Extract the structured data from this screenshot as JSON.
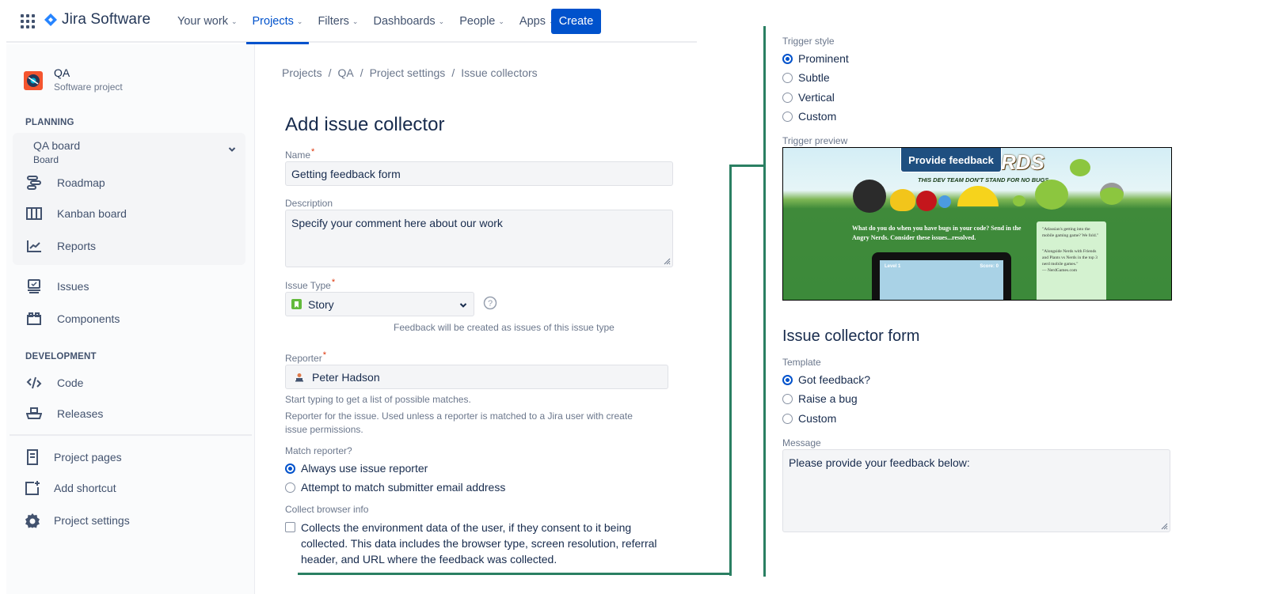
{
  "app": {
    "brand": "Jira Software",
    "nav": [
      {
        "label": "Your work",
        "active": false
      },
      {
        "label": "Projects",
        "active": true
      },
      {
        "label": "Filters",
        "active": false
      },
      {
        "label": "Dashboards",
        "active": false
      },
      {
        "label": "People",
        "active": false
      },
      {
        "label": "Apps",
        "active": false
      }
    ],
    "create_label": "Create",
    "accent": "#0052cc"
  },
  "sidebar": {
    "project_name": "QA",
    "project_type": "Software project",
    "planning_title": "PLANNING",
    "board": {
      "name": "QA board",
      "sub": "Board"
    },
    "planning_items": [
      {
        "label": "Roadmap",
        "icon": "roadmap-icon"
      },
      {
        "label": "Kanban board",
        "icon": "kanban-board-icon"
      },
      {
        "label": "Reports",
        "icon": "reports-icon"
      }
    ],
    "items": [
      {
        "label": "Issues",
        "icon": "issues-icon"
      },
      {
        "label": "Components",
        "icon": "components-icon"
      }
    ],
    "development_title": "DEVELOPMENT",
    "development_items": [
      {
        "label": "Code",
        "icon": "code-icon"
      },
      {
        "label": "Releases",
        "icon": "releases-icon"
      }
    ],
    "footer_items": [
      {
        "label": "Project pages",
        "icon": "project-pages-icon"
      },
      {
        "label": "Add shortcut",
        "icon": "add-shortcut-icon"
      },
      {
        "label": "Project settings",
        "icon": "gear-icon"
      }
    ]
  },
  "main": {
    "breadcrumb": [
      "Projects",
      "QA",
      "Project settings",
      "Issue collectors"
    ],
    "breadcrumb_sep": "/",
    "title": "Add issue collector",
    "name_label": "Name",
    "name_value": "Getting feedback form",
    "description_label": "Description",
    "description_value": "Specify your comment here about our work",
    "issue_type_label": "Issue Type",
    "issue_type_value": "Story",
    "issue_type_help": "Feedback will be created as issues of this issue type",
    "reporter_label": "Reporter",
    "reporter_value": "Peter Hadson",
    "reporter_help1": "Start typing to get a list of possible matches.",
    "reporter_help2": "Reporter for the issue. Used unless a reporter is matched to a Jira user with create issue permissions.",
    "match_label": "Match reporter?",
    "match_options": [
      {
        "label": "Always use issue reporter",
        "selected": true
      },
      {
        "label": "Attempt to match submitter email address",
        "selected": false
      }
    ],
    "browser_label": "Collect browser info",
    "browser_checkbox": {
      "label": "Collects the environment data of the user, if they consent to it being collected. This data includes the browser type, screen resolution, referral header, and URL where the feedback was collected.",
      "checked": false
    },
    "required_mark": "*"
  },
  "right": {
    "trigger_style_label": "Trigger style",
    "trigger_styles": [
      {
        "label": "Prominent",
        "selected": true
      },
      {
        "label": "Subtle",
        "selected": false
      },
      {
        "label": "Vertical",
        "selected": false
      },
      {
        "label": "Custom",
        "selected": false
      }
    ],
    "trigger_preview_label": "Trigger preview",
    "preview_button": "Provide feedback",
    "preview_tagline": "THIS DEV TEAM DON'T STAND FOR NO BUGS",
    "preview_text": "What do you do when you have bugs in your code? Send in the Angry Nerds. Consider these issues...resolved.",
    "preview_quote1": "\"Atlassian's getting into the mobile gaming game? We fold.\"",
    "preview_quote2": "\"Alongside Nerds with Friends and Plants vs Nerds in the top 3 nerd mobile games.\"",
    "preview_quote2_source": "— NerdGames.com",
    "preview_level": "Level 1",
    "preview_score": "Score: 0",
    "form_title": "Issue collector form",
    "template_label": "Template",
    "templates": [
      {
        "label": "Got feedback?",
        "selected": true
      },
      {
        "label": "Raise a bug",
        "selected": false
      },
      {
        "label": "Custom",
        "selected": false
      }
    ],
    "message_label": "Message",
    "message_value": "Please provide your feedback below:"
  }
}
